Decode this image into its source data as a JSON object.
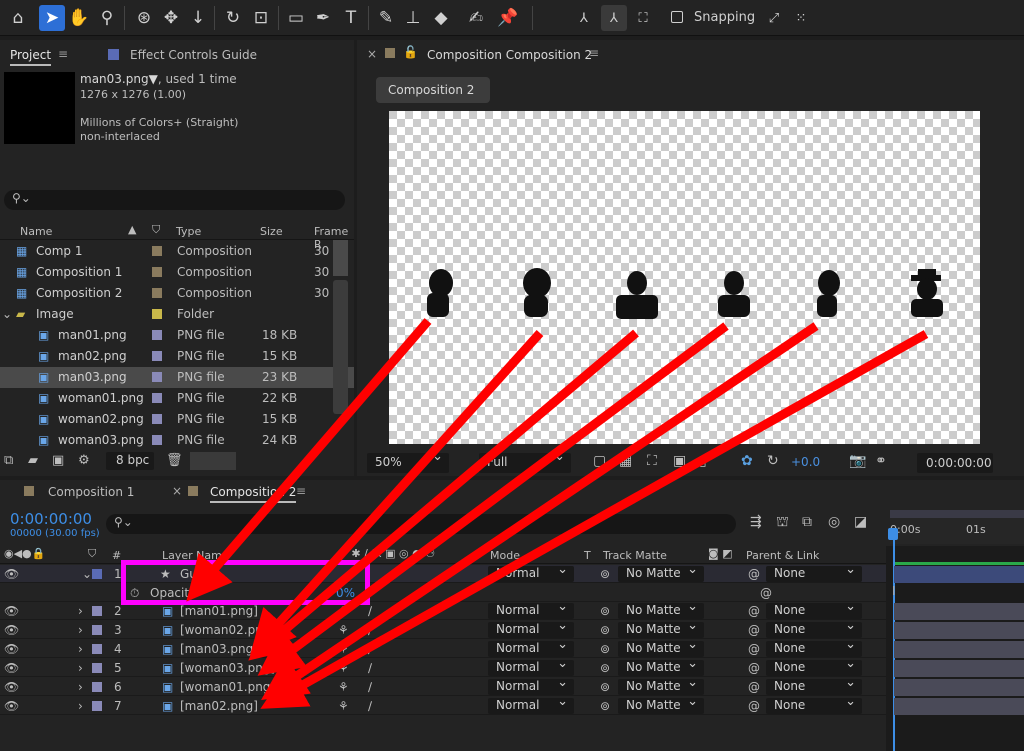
{
  "toolbar": {
    "snapping": "Snapping"
  },
  "project": {
    "tab_project": "Project",
    "tab_effect": "Effect Controls Guide",
    "preview_name": "man03.png▼",
    "preview_used": ", used 1 time",
    "preview_dims": "1276 x 1276 (1.00)",
    "preview_colors": "Millions of Colors+ (Straight)",
    "preview_interlace": "non-interlaced",
    "search_placeholder": "",
    "headers": {
      "name": "Name",
      "type": "Type",
      "size": "Size",
      "frame": "Frame R"
    },
    "items": [
      {
        "name": "Comp 1",
        "type": "Composition",
        "size": "",
        "frame": "30",
        "color": "#8a7b5e"
      },
      {
        "name": "Composition 1",
        "type": "Composition",
        "size": "",
        "frame": "30",
        "color": "#8a7b5e"
      },
      {
        "name": "Composition 2",
        "type": "Composition",
        "size": "",
        "frame": "30",
        "color": "#8a7b5e"
      },
      {
        "name": "Image",
        "type": "Folder",
        "size": "",
        "frame": "",
        "color": "#c9b84a"
      },
      {
        "name": "man01.png",
        "type": "PNG file",
        "size": "18 KB",
        "frame": "",
        "color": "#8a8ab8"
      },
      {
        "name": "man02.png",
        "type": "PNG file",
        "size": "15 KB",
        "frame": "",
        "color": "#8a8ab8"
      },
      {
        "name": "man03.png",
        "type": "PNG file",
        "size": "23 KB",
        "frame": "",
        "color": "#8a8ab8"
      },
      {
        "name": "woman01.png",
        "type": "PNG file",
        "size": "22 KB",
        "frame": "",
        "color": "#8a8ab8"
      },
      {
        "name": "woman02.png",
        "type": "PNG file",
        "size": "15 KB",
        "frame": "",
        "color": "#8a8ab8"
      },
      {
        "name": "woman03.png",
        "type": "PNG file",
        "size": "24 KB",
        "frame": "",
        "color": "#8a8ab8"
      }
    ],
    "bpc": "8 bpc"
  },
  "viewer": {
    "tab": "Composition Composition 2",
    "comp_button": "Composition 2",
    "zoom": "50%",
    "resolution": "Full",
    "exposure": "+0.0",
    "timecode": "0:00:00:00"
  },
  "timeline": {
    "tab1": "Composition 1",
    "tab2": "Composition 2",
    "time": "0:00:00:00",
    "fps": "00000 (30.00 fps)",
    "ruler_0": "0:00s",
    "ruler_1": "01s",
    "col_layer": "Layer Name",
    "col_mode": "Mode",
    "col_t": "T",
    "col_matte": "Track Matte",
    "col_parent": "Parent & Link",
    "guide": {
      "num": "1",
      "name": "Guide",
      "mode": "Normal",
      "matte": "No Matte",
      "parent": "None"
    },
    "opacity": {
      "label": "Opacity",
      "value": "0%"
    },
    "layers": [
      {
        "num": "2",
        "name": "[man01.png]",
        "mode": "Normal",
        "matte": "No Matte",
        "parent": "None"
      },
      {
        "num": "3",
        "name": "[woman02.png]",
        "mode": "Normal",
        "matte": "No Matte",
        "parent": "None"
      },
      {
        "num": "4",
        "name": "[man03.png]",
        "mode": "Normal",
        "matte": "No Matte",
        "parent": "None"
      },
      {
        "num": "5",
        "name": "[woman03.png]",
        "mode": "Normal",
        "matte": "No Matte",
        "parent": "None"
      },
      {
        "num": "6",
        "name": "[woman01.png]",
        "mode": "Normal",
        "matte": "No Matte",
        "parent": "None"
      },
      {
        "num": "7",
        "name": "[man02.png]",
        "mode": "Normal",
        "matte": "No Matte",
        "parent": "None"
      }
    ]
  },
  "colors": {
    "accent": "#2d6fd6",
    "arrow": "#ff0000",
    "highlight": "#ff00ff",
    "layer_bar": "#4a4a58"
  }
}
